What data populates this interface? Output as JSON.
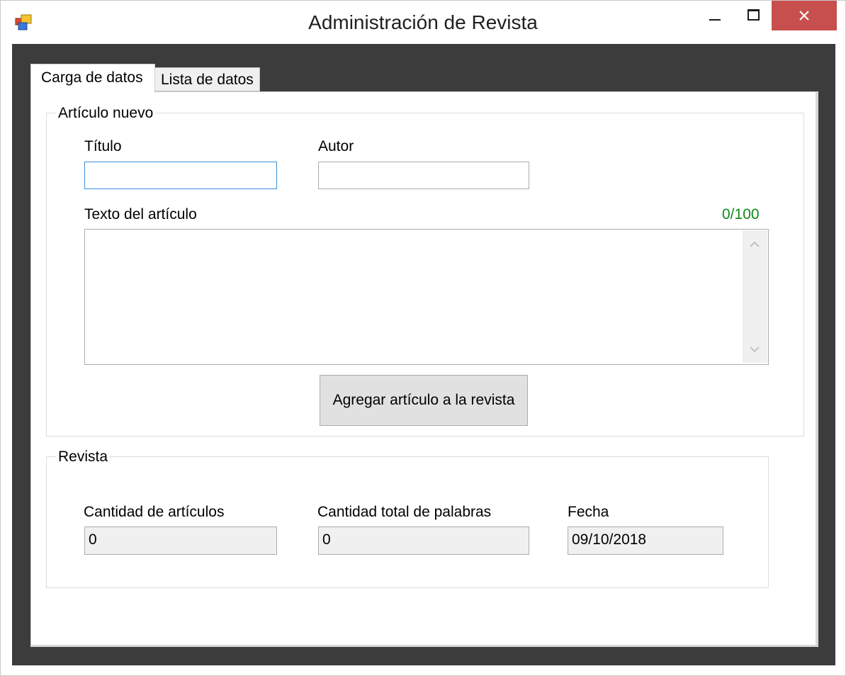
{
  "window": {
    "title": "Administración de Revista",
    "icon": "app-window-icon",
    "controls": [
      "minimize-icon",
      "maximize-icon",
      "close-icon"
    ],
    "close_color": "#c7504e"
  },
  "tabs": [
    {
      "label": "Carga de datos",
      "active": true
    },
    {
      "label": "Lista de datos",
      "active": false
    }
  ],
  "articulo_nuevo": {
    "legend": "Artículo nuevo",
    "titulo_label": "Título",
    "titulo_value": "",
    "autor_label": "Autor",
    "autor_value": "",
    "texto_label": "Texto del artículo",
    "texto_value": "",
    "counter": "0/100",
    "counter_color": "#0f8a1a",
    "add_button": "Agregar artículo a la revista"
  },
  "revista": {
    "legend": "Revista",
    "cantidad_articulos_label": "Cantidad de artículos",
    "cantidad_articulos_value": "0",
    "cantidad_palabras_label": "Cantidad total de palabras",
    "cantidad_palabras_value": "0",
    "fecha_label": "Fecha",
    "fecha_value": "09/10/2018"
  }
}
